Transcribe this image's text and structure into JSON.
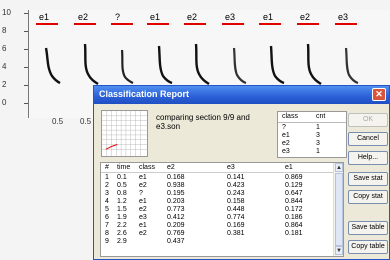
{
  "spectrogram": {
    "y_ticks": [
      "10",
      "8",
      "6",
      "4",
      "2",
      "0"
    ],
    "x_ticks": [
      "0.5",
      "0.5"
    ],
    "segment_labels": [
      "e1",
      "e2",
      "?",
      "e1",
      "e2",
      "e3",
      "e1",
      "e2",
      "e3"
    ],
    "segment_line_color": "#e00000"
  },
  "dialog": {
    "title": "Classification Report",
    "close_icon": "close-icon",
    "description": "comparing section 9/9 and e3.son",
    "summary": {
      "headers": [
        "class",
        "cnt"
      ],
      "rows": [
        {
          "class": "?",
          "cnt": "1"
        },
        {
          "class": "e1",
          "cnt": "3"
        },
        {
          "class": "e2",
          "cnt": "3"
        },
        {
          "class": "e3",
          "cnt": "1"
        }
      ]
    },
    "buttons": {
      "ok": "OK",
      "cancel": "Cancel",
      "help": "Help...",
      "save_stat": "Save stat",
      "copy_stat": "Copy stat",
      "save_table": "Save table",
      "copy_table": "Copy table"
    },
    "table": {
      "headers": [
        "#",
        "time",
        "class",
        "e2",
        "e3",
        "e1"
      ],
      "rows": [
        [
          "1",
          "0.1",
          "e1",
          "0.168",
          "0.141",
          "0.869"
        ],
        [
          "2",
          "0.5",
          "e2",
          "0.938",
          "0.423",
          "0.129"
        ],
        [
          "3",
          "0.8",
          "?",
          "0.195",
          "0.243",
          "0.647"
        ],
        [
          "4",
          "1.2",
          "e1",
          "0.203",
          "0.158",
          "0.844"
        ],
        [
          "5",
          "1.5",
          "e2",
          "0.773",
          "0.448",
          "0.172"
        ],
        [
          "6",
          "1.9",
          "e3",
          "0.412",
          "0.774",
          "0.186"
        ],
        [
          "7",
          "2.2",
          "e1",
          "0.209",
          "0.169",
          "0.864"
        ],
        [
          "8",
          "2.6",
          "e2",
          "0.769",
          "0.381",
          "0.181"
        ],
        [
          "9",
          "2.9",
          "",
          "0.437",
          "",
          ""
        ]
      ]
    }
  }
}
